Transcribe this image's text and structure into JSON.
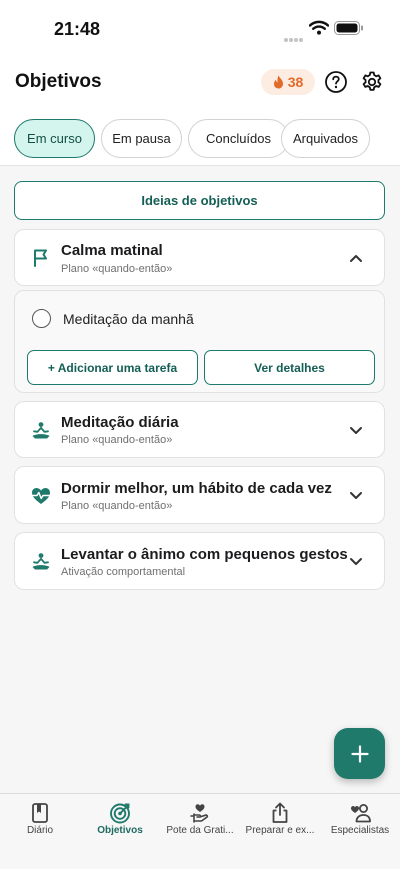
{
  "status_bar": {
    "time": "21:48"
  },
  "header": {
    "title": "Objetivos",
    "streak_count": "38"
  },
  "tabs": [
    {
      "label": "Em curso",
      "active": true
    },
    {
      "label": "Em pausa",
      "active": false
    },
    {
      "label": "Concluídos",
      "active": false
    },
    {
      "label": "Arquivados",
      "active": false
    }
  ],
  "ideas_button": {
    "label": "Ideias de objetivos"
  },
  "goals": [
    {
      "title": "Calma matinal",
      "subtitle": "Plano «quando-então»",
      "icon": "flag-icon",
      "expanded": true
    },
    {
      "title": "Meditação diária",
      "subtitle": "Plano «quando-então»",
      "icon": "meditation-icon",
      "expanded": false
    },
    {
      "title": "Dormir melhor, um hábito de cada vez",
      "subtitle": "Plano «quando-então»",
      "icon": "heartbeat-icon",
      "expanded": false
    },
    {
      "title": "Levantar o ânimo com pequenos gestos",
      "subtitle": "Ativação comportamental",
      "icon": "meditation-icon",
      "expanded": false
    }
  ],
  "expanded_goal": {
    "task": "Meditação da manhã",
    "add_task_label": "+ Adicionar uma tarefa",
    "details_label": "Ver detalhes"
  },
  "bottom_nav": [
    {
      "label": "Diário",
      "icon": "book-icon",
      "active": false
    },
    {
      "label": "Objetivos",
      "icon": "target-icon",
      "active": true
    },
    {
      "label": "Pote da Grati...",
      "icon": "gratitude-jar-icon",
      "active": false
    },
    {
      "label": "Preparar e ex...",
      "icon": "share-icon",
      "active": false
    },
    {
      "label": "Especialistas",
      "icon": "specialists-icon",
      "active": false
    }
  ],
  "colors": {
    "accent": "#1f7a6c",
    "tab_active_bg": "#d4f4ee",
    "streak": "#e26b2b"
  }
}
